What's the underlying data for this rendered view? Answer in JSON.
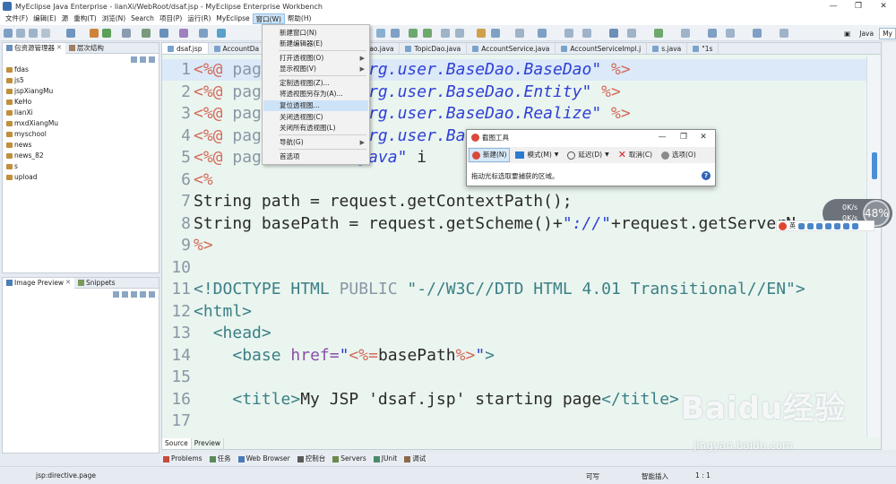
{
  "window": {
    "title": "MyEclipse Java Enterprise - lianXi/WebRoot/dsaf.jsp - MyEclipse Enterprise Workbench",
    "controls": [
      "—",
      "❐",
      "✕"
    ]
  },
  "menubar": [
    "文件(F)",
    "编辑(E)",
    "源",
    "重构(T)",
    "浏览(N)",
    "Search",
    "项目(P)",
    "运行(R)",
    "MyEclipse",
    "窗口(W)",
    "帮助(H)"
  ],
  "perspectives": {
    "java": "Java",
    "myeclipse": "My"
  },
  "package_view": {
    "tabs": [
      "包资源管理器",
      "层次结构"
    ],
    "projects": [
      "fdas",
      "js5",
      "jspXiangMu",
      "KeHo",
      "lianXi",
      "mxdXiangMu",
      "myschool",
      "news",
      "news_82",
      "s",
      "upload"
    ]
  },
  "image_view": {
    "tabs": [
      "Image Preview",
      "Snippets"
    ]
  },
  "editor": {
    "tabs": [
      "dsaf.jsp",
      "AccountDa",
      "",
      ".java",
      "AccountDao.java",
      "TopicDao.java",
      "AccountService.java",
      "AccountServiceImpl.j",
      "s.java",
      "\"1s"
    ],
    "bottom_tabs": [
      "Source",
      "Preview"
    ],
    "lines": [
      {
        "n": "1",
        "t": [
          [
            "c-jsp",
            "<%@ "
          ],
          [
            "c-kw",
            "pag"
          ],
          [
            "c-plain",
            "          "
          ],
          [
            "c-str",
            "org.user.BaseDao.BaseDao\""
          ],
          [
            "c-jsp",
            " %>"
          ]
        ]
      },
      {
        "n": "2",
        "t": [
          [
            "c-jsp",
            "<%@ "
          ],
          [
            "c-kw",
            "pag"
          ],
          [
            "c-plain",
            "          "
          ],
          [
            "c-str",
            "org.user.BaseDao.Entity\""
          ],
          [
            "c-jsp",
            " %>"
          ]
        ]
      },
      {
        "n": "3",
        "t": [
          [
            "c-jsp",
            "<%@ "
          ],
          [
            "c-kw",
            "pag"
          ],
          [
            "c-plain",
            "          "
          ],
          [
            "c-str",
            "org.user.BaseDao.Realize\""
          ],
          [
            "c-jsp",
            " %>"
          ]
        ]
      },
      {
        "n": "4",
        "t": [
          [
            "c-jsp",
            "<%@ "
          ],
          [
            "c-kw",
            "pag"
          ],
          [
            "c-plain",
            "          "
          ],
          [
            "c-str",
            "org.user.BaseDao.Dao\""
          ],
          [
            "c-jsp",
            "%"
          ]
        ]
      },
      {
        "n": "5",
        "t": [
          [
            "c-jsp",
            "<%@ "
          ],
          [
            "c-kw",
            "pag"
          ],
          [
            "c-plain",
            "        "
          ],
          [
            "c-str",
            "=\"java\""
          ],
          [
            "c-plain",
            " i"
          ],
          [
            "c-plain",
            "              "
          ],
          [
            "c-str",
            "ql.*\""
          ],
          [
            "c-attr",
            " pageEnco"
          ]
        ]
      },
      {
        "n": "6",
        "t": [
          [
            "c-jsp",
            "<%"
          ]
        ]
      },
      {
        "n": "7",
        "t": [
          [
            "c-plain",
            "String path = request.getContextPath();"
          ]
        ]
      },
      {
        "n": "8",
        "t": [
          [
            "c-plain",
            "String basePath = request.getScheme()+"
          ],
          [
            "c-str",
            "\"://\""
          ],
          [
            "c-plain",
            "+request.getServerN"
          ]
        ]
      },
      {
        "n": "9",
        "t": [
          [
            "c-jsp",
            "%>"
          ]
        ]
      },
      {
        "n": "10",
        "t": []
      },
      {
        "n": "11",
        "t": [
          [
            "c-tag",
            "<!DOCTYPE HTML "
          ],
          [
            "c-kw",
            "PUBLIC "
          ],
          [
            "c-tag",
            "\"-//W3C//DTD HTML 4.01 Transitional//EN\">"
          ]
        ]
      },
      {
        "n": "12",
        "t": [
          [
            "c-tag",
            "<html>"
          ]
        ]
      },
      {
        "n": "13",
        "t": [
          [
            "c-plain",
            "  "
          ],
          [
            "c-tag",
            "<head>"
          ]
        ]
      },
      {
        "n": "14",
        "t": [
          [
            "c-plain",
            "    "
          ],
          [
            "c-tag",
            "<base "
          ],
          [
            "c-attr",
            "href="
          ],
          [
            "c-hstr",
            "\""
          ],
          [
            "c-jsp",
            "<%="
          ],
          [
            "c-plain",
            "basePath"
          ],
          [
            "c-jsp",
            "%>"
          ],
          [
            "c-hstr",
            "\""
          ],
          [
            "c-tag",
            ">"
          ]
        ]
      },
      {
        "n": "15",
        "t": []
      },
      {
        "n": "16",
        "t": [
          [
            "c-plain",
            "    "
          ],
          [
            "c-tag",
            "<title>"
          ],
          [
            "c-plain",
            "My JSP 'dsaf.jsp' starting page"
          ],
          [
            "c-tag",
            "</title>"
          ]
        ]
      },
      {
        "n": "17",
        "t": []
      }
    ]
  },
  "window_menu": {
    "items": [
      {
        "label": "新建窗口(N)",
        "arrow": false
      },
      {
        "label": "新建编辑器(E)",
        "arrow": false
      },
      {
        "label": "打开透视图(O)",
        "arrow": true
      },
      {
        "label": "显示视图(V)",
        "arrow": true
      },
      {
        "label": "定制透视图(Z)...",
        "arrow": false
      },
      {
        "label": "将透视图另存为(A)...",
        "arrow": false
      },
      {
        "label": "复位透视图...",
        "arrow": false
      },
      {
        "label": "关闭透视图(C)",
        "arrow": false
      },
      {
        "label": "关闭所有透视图(L)",
        "arrow": false
      },
      {
        "label": "导航(G)",
        "arrow": true
      },
      {
        "label": "首选项",
        "arrow": false
      }
    ]
  },
  "snipping_tool": {
    "title": "截图工具",
    "tools": [
      "新建(N)",
      "模式(M)",
      "延迟(D)",
      "取消(C)",
      "选项(O)"
    ],
    "hint": "拖动光标选取要捕获的区域。",
    "help": "?"
  },
  "bottom_views": [
    "Problems",
    "任务",
    "Web Browser",
    "控制台",
    "Servers",
    "JUnit",
    "调试"
  ],
  "status": {
    "left": "jsp:directive.page",
    "writable": "可写",
    "insert": "智能插入",
    "position": "1 : 1"
  },
  "speed_widget": {
    "percent": "48%",
    "up": "0K/s",
    "down": "0K/s"
  },
  "ime": {
    "label": "英"
  },
  "watermark": {
    "main": "Baidu经验",
    "sub": "jingyan.baidu.com"
  },
  "colors": {
    "editor_bg": "#eaf5ef",
    "menu_highlight": "#cde3f7",
    "accent": "#4b8fd6"
  }
}
